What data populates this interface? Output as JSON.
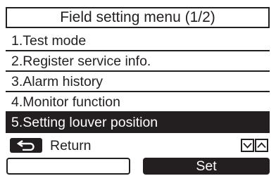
{
  "header": {
    "title": "Field setting menu (1/2)"
  },
  "menu": {
    "items": [
      {
        "label": "1.Test mode",
        "selected": false
      },
      {
        "label": "2.Register service info.",
        "selected": false
      },
      {
        "label": "3.Alarm history",
        "selected": false
      },
      {
        "label": "4.Monitor function",
        "selected": false
      },
      {
        "label": "5.Setting louver position",
        "selected": true
      }
    ]
  },
  "footer": {
    "return_icon": "return-arrow-icon",
    "return_label": "Return",
    "down_icon": "chevron-down-icon",
    "up_icon": "chevron-up-icon"
  },
  "buttons": {
    "left_label": "",
    "set_label": "Set"
  },
  "colors": {
    "foreground": "#231f20",
    "background": "#ffffff",
    "highlight": "#231f20"
  }
}
